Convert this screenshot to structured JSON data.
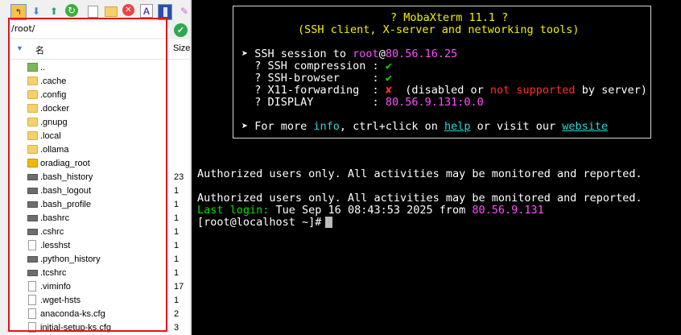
{
  "toolbar": {
    "buttons": [
      "upload-folder",
      "download",
      "upload",
      "refresh",
      "new-file",
      "new-folder",
      "delete",
      "text-edit",
      "permissions",
      "more"
    ]
  },
  "sftp": {
    "path": "/root/",
    "columns": {
      "name": "名",
      "size": "Size"
    },
    "files": [
      {
        "name": "..",
        "size": "",
        "type": "up"
      },
      {
        "name": ".cache",
        "size": "",
        "type": "folder"
      },
      {
        "name": ".config",
        "size": "",
        "type": "folder"
      },
      {
        "name": ".docker",
        "size": "",
        "type": "folder"
      },
      {
        "name": ".gnupg",
        "size": "",
        "type": "folder"
      },
      {
        "name": ".local",
        "size": "",
        "type": "folder"
      },
      {
        "name": ".ollama",
        "size": "",
        "type": "folder"
      },
      {
        "name": "oradiag_root",
        "size": "",
        "type": "folder-dark"
      },
      {
        "name": ".bash_history",
        "size": "23",
        "type": "term"
      },
      {
        "name": ".bash_logout",
        "size": "1",
        "type": "term"
      },
      {
        "name": ".bash_profile",
        "size": "1",
        "type": "term"
      },
      {
        "name": ".bashrc",
        "size": "1",
        "type": "term"
      },
      {
        "name": ".cshrc",
        "size": "1",
        "type": "term"
      },
      {
        "name": ".lesshst",
        "size": "1",
        "type": "doc"
      },
      {
        "name": ".python_history",
        "size": "1",
        "type": "term"
      },
      {
        "name": ".tcshrc",
        "size": "1",
        "type": "term"
      },
      {
        "name": ".viminfo",
        "size": "17",
        "type": "doc"
      },
      {
        "name": ".wget-hsts",
        "size": "1",
        "type": "doc"
      },
      {
        "name": "anaconda-ks.cfg",
        "size": "2",
        "type": "doc"
      },
      {
        "name": "initial-setup-ks.cfg",
        "size": "3",
        "type": "doc"
      }
    ]
  },
  "terminal": {
    "banner": {
      "title": "? MobaXterm 11.1 ?",
      "subtitle": "(SSH client, X-server and networking tools)",
      "session_prefix": "➤ SSH session to ",
      "session_user": "root",
      "session_at": "@",
      "session_host": "80.56.16.25",
      "compression_label": "  ? SSH compression : ",
      "compression_val": "✔",
      "browser_label": "  ? SSH-browser     : ",
      "browser_val": "✔",
      "x11_label": "  ? X11-forwarding  : ",
      "x11_val": "✘",
      "x11_note_a": "  (disabled ",
      "x11_note_or": "or ",
      "x11_note_ns": "not supported",
      "x11_note_b": " by server)",
      "display_label": "  ? DISPLAY         : ",
      "display_val": "80.56.9.131:0.0",
      "info_prefix": "➤ For more ",
      "info_word": "info",
      "info_mid": ", ctrl+click on ",
      "help_word": "help",
      "info_mid2": " or visit our ",
      "website_word": "website"
    },
    "auth_line_1": "Authorized users only. All activities may be monitored and reported.",
    "auth_line_2": "Authorized users only. All activities may be monitored and reported.",
    "last_login_label": "Last login:",
    "last_login_time": " Tue Sep 16 08:43:53 2025 from ",
    "last_login_ip": "80.56.9.131",
    "prompt": "[root@localhost ~]# ",
    "colors": {
      "yellow": "#f0f000",
      "magenta": "#ff4fff",
      "green": "#00e000",
      "red": "#ff3030",
      "cyan": "#28d8d8"
    }
  }
}
